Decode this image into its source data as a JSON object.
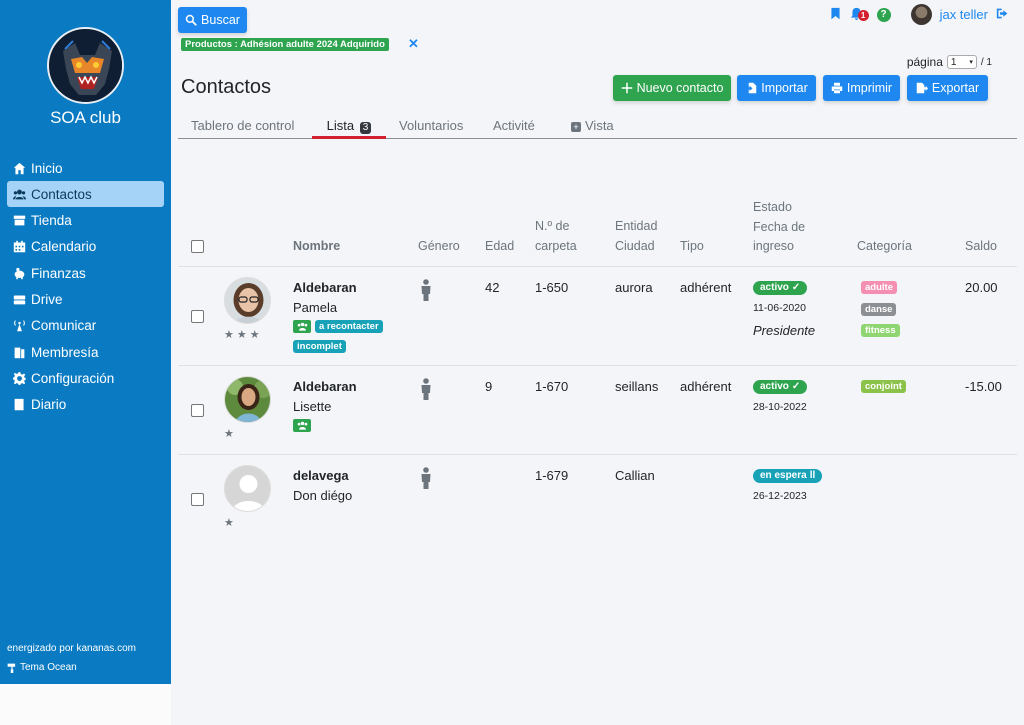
{
  "sidebar": {
    "club_name": "SOA club",
    "items": [
      {
        "label": "Inicio",
        "icon": "home-icon"
      },
      {
        "label": "Contactos",
        "icon": "users-icon"
      },
      {
        "label": "Tienda",
        "icon": "store-icon"
      },
      {
        "label": "Calendario",
        "icon": "calendar-icon"
      },
      {
        "label": "Finanzas",
        "icon": "piggy-bank-icon"
      },
      {
        "label": "Drive",
        "icon": "drive-icon"
      },
      {
        "label": "Comunicar",
        "icon": "broadcast-icon"
      },
      {
        "label": "Membresía",
        "icon": "membership-icon"
      },
      {
        "label": "Configuración",
        "icon": "gear-icon"
      },
      {
        "label": "Diario",
        "icon": "journal-icon"
      }
    ],
    "powered_by": "energizado por kananas.com",
    "theme": "Tema Ocean"
  },
  "header": {
    "search_label": "Buscar",
    "filter_chip": "Productos : Adhésion adulte 2024 Adquirido",
    "notifications_count": "1",
    "help": "?",
    "user_name": "jax teller"
  },
  "pager": {
    "label": "página",
    "current": "1",
    "total": "/ 1"
  },
  "page_title": "Contactos",
  "actions": {
    "new_contact": "Nuevo contacto",
    "import": "Importar",
    "print": "Imprimir",
    "export": "Exportar"
  },
  "tabs": {
    "dashboard": "Tablero de control",
    "list": "Lista",
    "list_count": "3",
    "volunteers": "Voluntarios",
    "activity": "Activité",
    "view": "Vista"
  },
  "columns": {
    "name": "Nombre",
    "gender": "Género",
    "age": "Edad",
    "folder_1": "N.º de",
    "folder_2": "carpeta",
    "entity_1": "Entidad",
    "entity_2": "Ciudad",
    "type": "Tipo",
    "status_1": "Estado",
    "status_2": "Fecha de",
    "status_3": "ingreso",
    "category": "Categoría",
    "balance": "Saldo"
  },
  "rows": [
    {
      "last_name": "Aldebaran",
      "first_name": "Pamela",
      "tags": [
        "a recontacter",
        "incomplet"
      ],
      "age": "42",
      "folder": "1-650",
      "city": "aurora",
      "type": "adhérent",
      "status": "activo",
      "date": "11-06-2020",
      "role": "Presidente",
      "categories": [
        "adulte",
        "danse",
        "fitness"
      ],
      "balance": "20.00",
      "stars": "★★★"
    },
    {
      "last_name": "Aldebaran",
      "first_name": "Lisette",
      "tags": [],
      "age": "9",
      "folder": "1-670",
      "city": "seillans",
      "type": "adhérent",
      "status": "activo",
      "date": "28-10-2022",
      "role": "",
      "categories": [
        "conjoint"
      ],
      "balance": "-15.00",
      "stars": "★"
    },
    {
      "last_name": "delavega",
      "first_name": "Don diégo",
      "tags": [],
      "age": "",
      "folder": "1-679",
      "city": "Callian",
      "type": "",
      "status": "en espera",
      "date": "26-12-2023",
      "role": "",
      "categories": [],
      "balance": "",
      "stars": "★"
    }
  ],
  "colors": {
    "sidebar": "#0a7bc2",
    "primary": "#1e88f0",
    "success": "#2ea44f",
    "info": "#17a2b8",
    "danger": "#d3202f"
  }
}
